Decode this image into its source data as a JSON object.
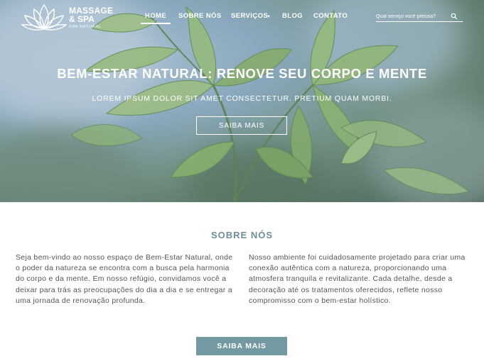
{
  "brand": {
    "line1": "MASSAGE",
    "line2": "& SPA",
    "tagline": "SPA NATURAL"
  },
  "nav": {
    "items": [
      {
        "label": "HOME",
        "active": true
      },
      {
        "label": "SOBRE NÓS"
      },
      {
        "label": "SERVIÇOS",
        "has_dropdown": true
      },
      {
        "label": "BLOG"
      },
      {
        "label": "CONTATO"
      }
    ]
  },
  "search": {
    "placeholder": "Qual serviço você precisa?",
    "value": ""
  },
  "hero": {
    "title": "BEM-ESTAR NATURAL: RENOVE SEU CORPO E MENTE",
    "subtitle": "LOREM IPSUM DOLOR SIT AMET CONSECTETUR. PRETIUM QUAM MORBI.",
    "button_label": "SAIBA MAIS"
  },
  "about": {
    "title": "SOBRE NÓS",
    "paragraph_left": "Seja bem-vindo ao nosso espaço de Bem-Estar Natural, onde o poder da natureza se encontra com a busca pela harmonia do corpo e da mente. Em nosso refúgio, convidamos você a deixar para trás as preocupações do dia a dia e se entregar a uma jornada de renovação profunda.",
    "paragraph_right": "Nosso ambiente foi cuidadosamente projetado para criar uma conexão autêntica com a natureza, proporcionando uma atmosfera tranquila e revitalizante. Cada detalhe, desde a decoração até os tratamentos oferecidos, reflete nosso compromisso com o bem-estar holístico.",
    "button_label": "SAIBA MAIS"
  },
  "colors": {
    "accent": "#7399a3",
    "heading": "#6d8d9a",
    "body_text": "#555555"
  },
  "icons": {
    "logo": "lotus-icon",
    "search": "search-icon",
    "dropdown": "caret-down-icon"
  }
}
